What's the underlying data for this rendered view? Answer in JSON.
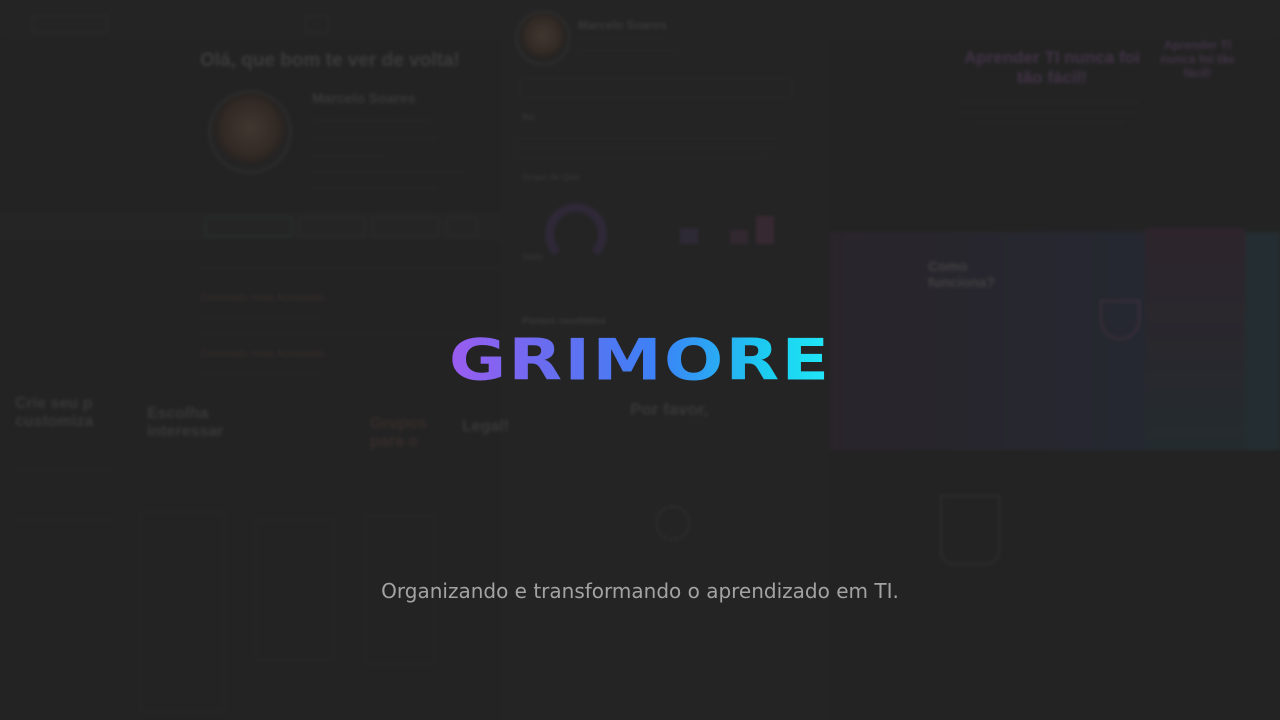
{
  "splash": {
    "logo_text": "GRIMORE",
    "tagline": "Organizando e transformando o aprendizado em TI."
  },
  "background": {
    "profile": {
      "greeting": "Olá, que bom te ver de volta!",
      "user_name": "Marcelo Soares",
      "tabs": [
        "Personalizadas",
        "Personalizada",
        "Transparência",
        "Rede"
      ]
    },
    "profile_card": {
      "user_name": "Marcelo Soares",
      "section_bio": "Bio",
      "section_quiz": "Grupo de Quiz",
      "section_skills": "Skills",
      "section_achievements": "Pontos recebidos"
    },
    "landing": {
      "headline_a": "Aprender TI nunca foi tão fácil!",
      "headline_b": "Aprender TI nunca foi tão fácil!",
      "how_it_works": "Como funciona?"
    },
    "bottom_left": {
      "title_a": "Crie seu p customiza",
      "title_b": "Escolha interessar",
      "title_c": "Grupos para o",
      "title_d": "Legal!"
    },
    "center": {
      "please": "Por favor,"
    }
  },
  "colors": {
    "background": "#272727",
    "logo_gradient_start": "#9b5cf0",
    "logo_gradient_end": "#22e8f8",
    "tagline": "#a3a3a3"
  }
}
